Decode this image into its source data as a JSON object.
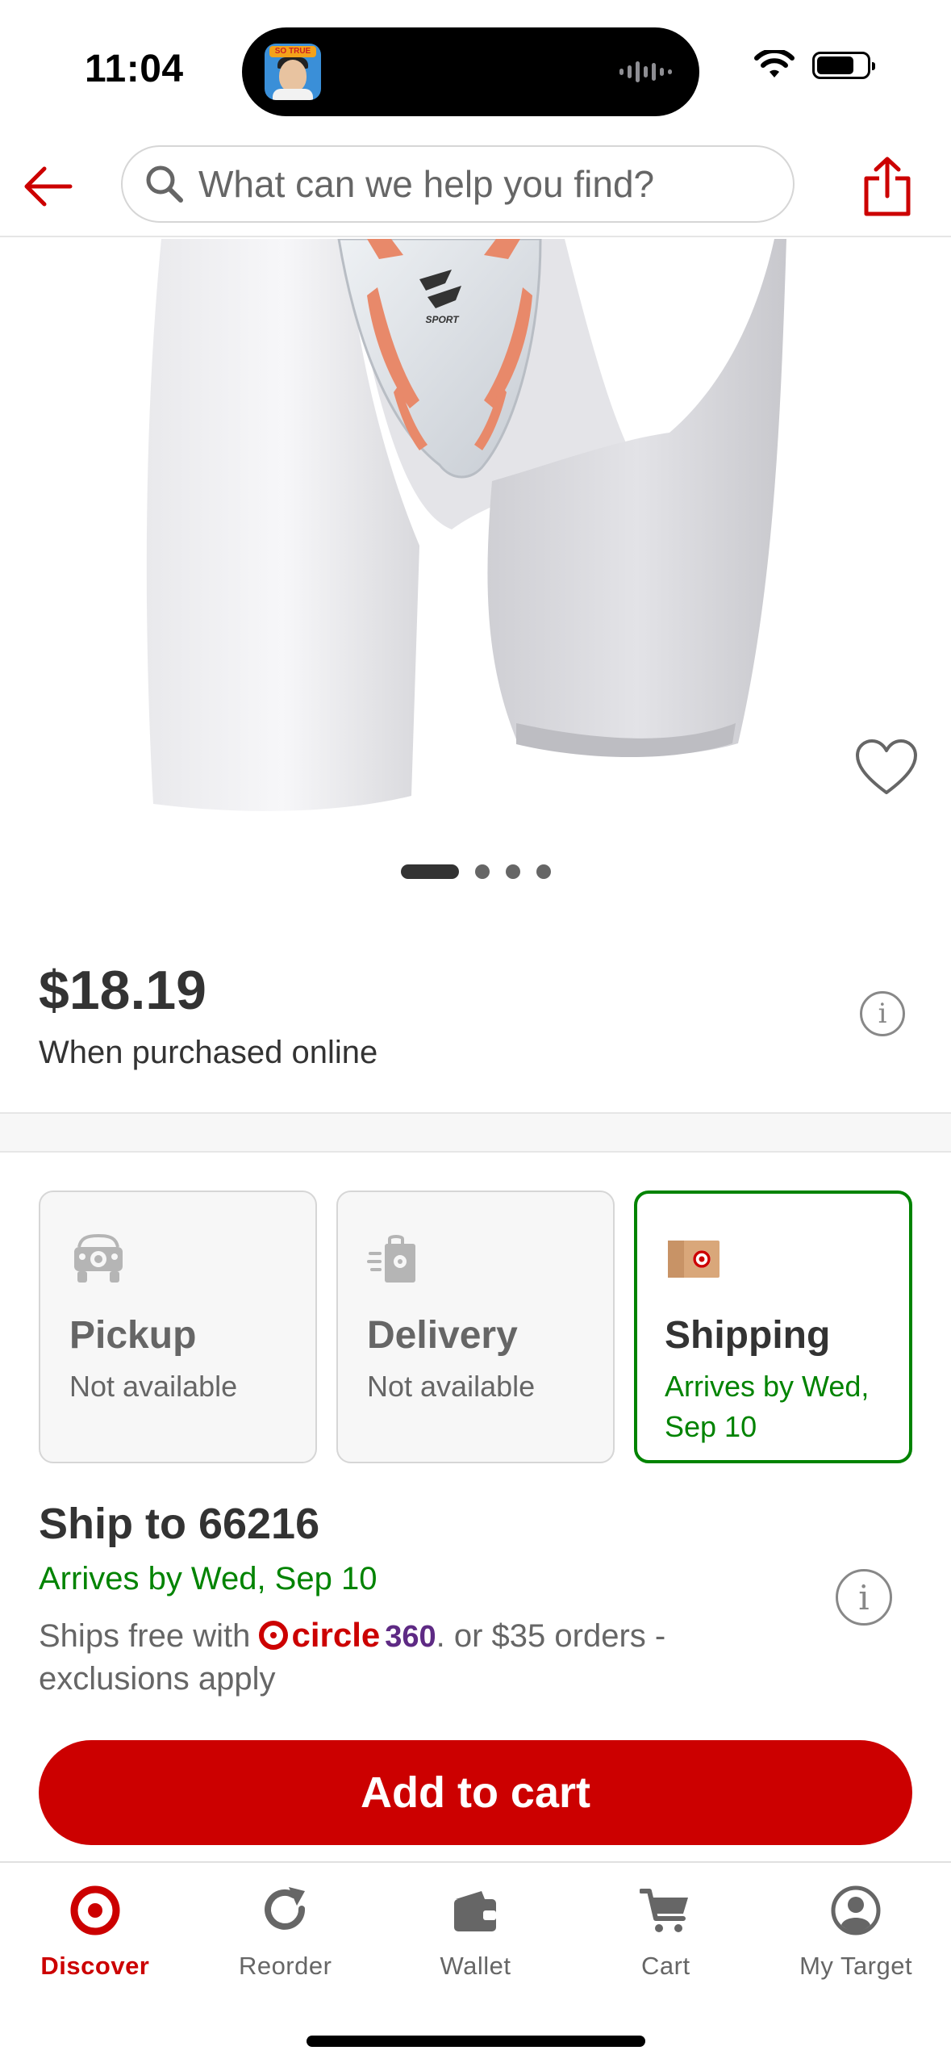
{
  "status_bar": {
    "time": "11:04",
    "island_badge": "SO TRUE"
  },
  "header": {
    "search_placeholder": "What can we help you find?"
  },
  "product": {
    "image_brand_text": "SPORT",
    "carousel": {
      "total": 4,
      "active": 1
    }
  },
  "price": {
    "amount": "$18.19",
    "note": "When purchased online"
  },
  "fulfillment": [
    {
      "title": "Pickup",
      "status": "Not available",
      "selected": false,
      "icon": "car-icon"
    },
    {
      "title": "Delivery",
      "status": "Not available",
      "selected": false,
      "icon": "delivery-bag-icon"
    },
    {
      "title": "Shipping",
      "status": "Arrives by Wed, Sep 10",
      "selected": true,
      "icon": "shipping-box-icon"
    }
  ],
  "shipping": {
    "title": "Ship to 66216",
    "arrives": "Arrives by Wed, Sep 10",
    "free_prefix": "Ships free with",
    "circle_word": "circle",
    "circle_num": "360",
    "free_suffix": ". or $35 orders - exclusions apply"
  },
  "actions": {
    "add_to_cart": "Add to cart"
  },
  "tabs": [
    {
      "label": "Discover",
      "active": true,
      "icon": "target-bullseye-icon"
    },
    {
      "label": "Reorder",
      "active": false,
      "icon": "reorder-icon"
    },
    {
      "label": "Wallet",
      "active": false,
      "icon": "wallet-icon"
    },
    {
      "label": "Cart",
      "active": false,
      "icon": "cart-icon"
    },
    {
      "label": "My Target",
      "active": false,
      "icon": "account-icon"
    }
  ],
  "colors": {
    "brand_red": "#cc0000",
    "success_green": "#008300",
    "circle_purple": "#5e2a84"
  }
}
